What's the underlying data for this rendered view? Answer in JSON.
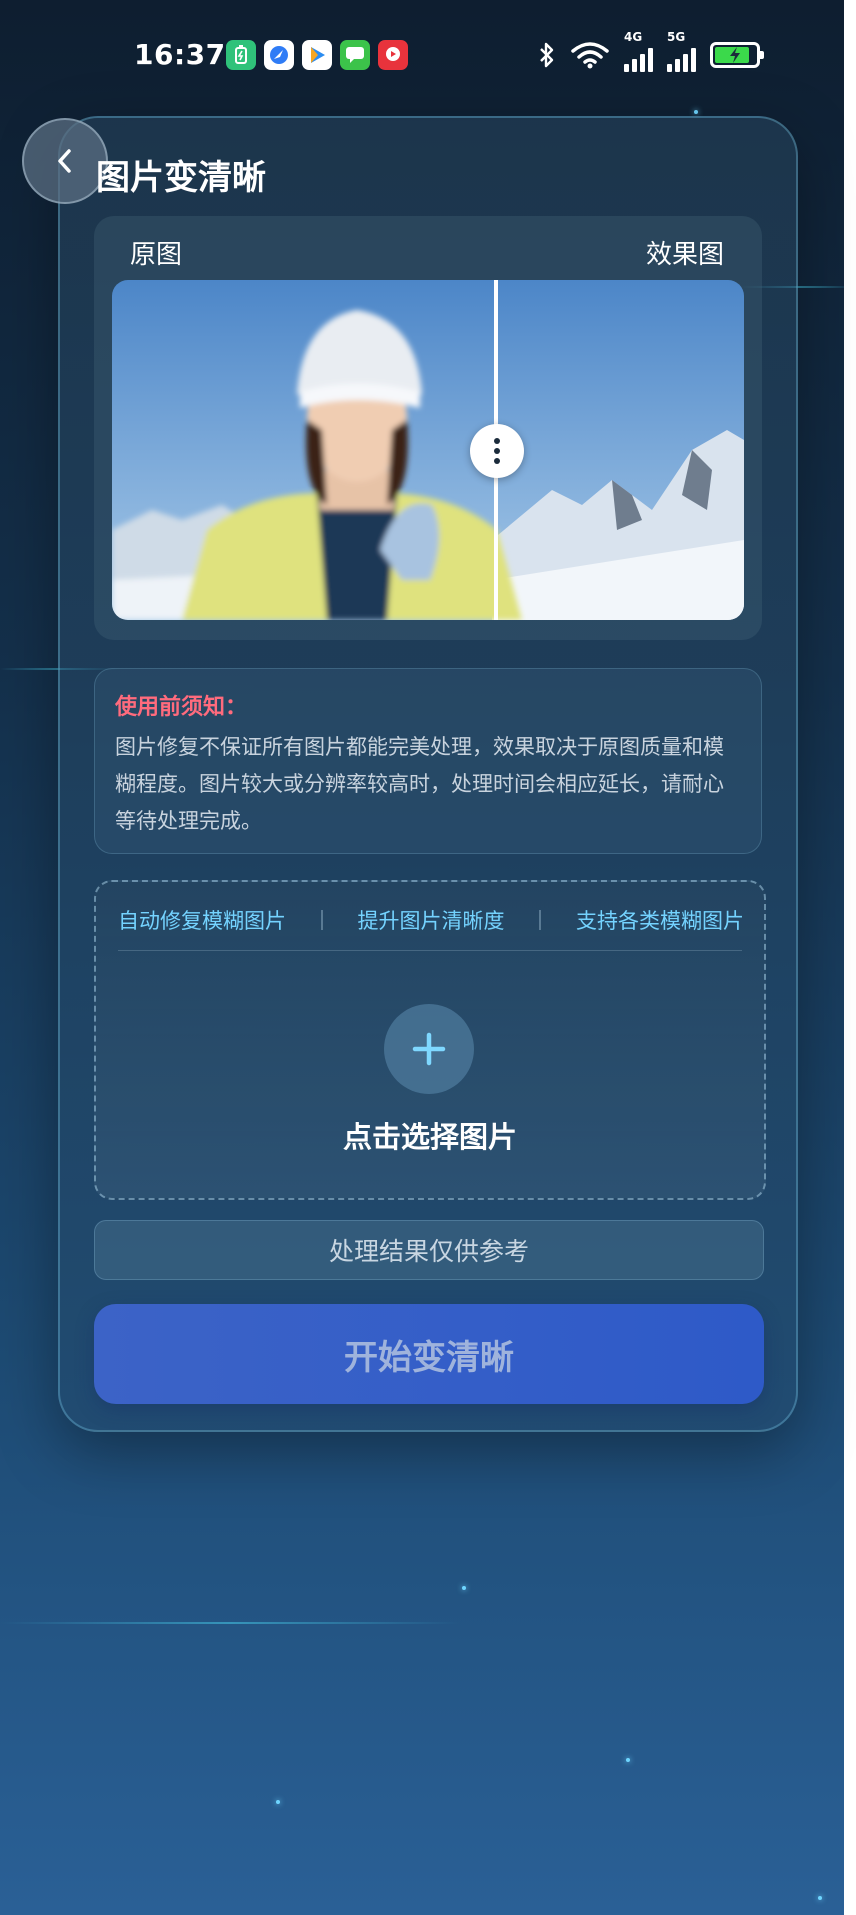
{
  "status_bar": {
    "time": "16:37",
    "signal_4g": "4G",
    "signal_5g": "5G",
    "icons": [
      "battery-app-icon",
      "browser-icon",
      "video-player-icon",
      "messages-icon",
      "video-app-icon",
      "bluetooth-icon",
      "wifi-icon",
      "signal-4g-icon",
      "signal-5g-icon",
      "battery-charging-icon"
    ]
  },
  "header": {
    "title": "图片变清晰"
  },
  "compare": {
    "left_label": "原图",
    "right_label": "效果图"
  },
  "notice": {
    "title": "使用前须知：",
    "text": "图片修复不保证所有图片都能完美处理，效果取决于原图质量和模糊程度。图片较大或分辨率较高时，处理时间会相应延长，请耐心等待处理完成。"
  },
  "upload": {
    "features": [
      "自动修复模糊图片",
      "提升图片清晰度",
      "支持各类模糊图片"
    ],
    "label": "点击选择图片"
  },
  "reference_text": "处理结果仅供参考",
  "start_button": "开始变清晰",
  "colors": {
    "accent_cyan": "#74d3ff",
    "warning_red": "#ff6b7d",
    "button_blue": "#3c63c7"
  }
}
